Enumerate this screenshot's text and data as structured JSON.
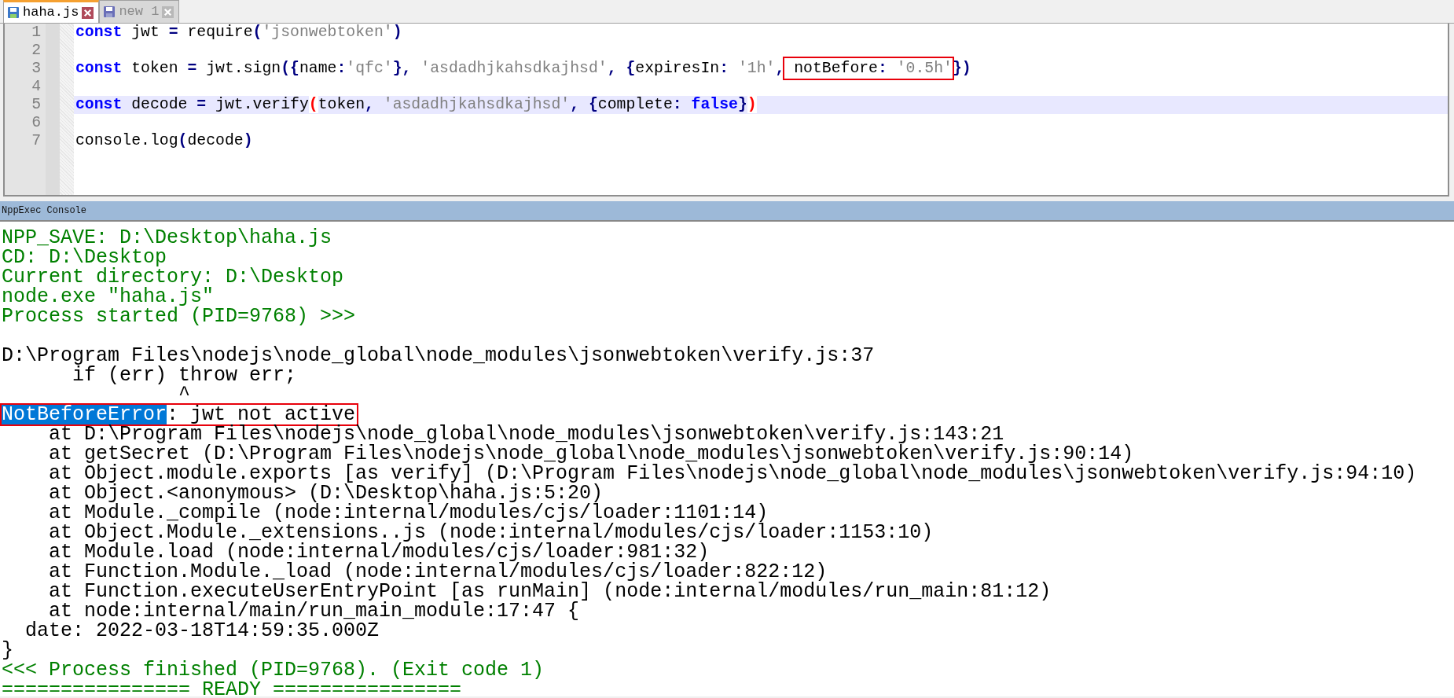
{
  "tabs": [
    {
      "label": "haha.js",
      "selected": true
    },
    {
      "label": "new 1",
      "selected": false
    }
  ],
  "editor": {
    "lines": [
      {
        "number": "1",
        "current": false,
        "tokens": [
          {
            "kind": "kw",
            "text": "const"
          },
          {
            "kind": "plain",
            "text": " jwt "
          },
          {
            "kind": "op",
            "text": "="
          },
          {
            "kind": "plain",
            "text": " require"
          },
          {
            "kind": "op",
            "text": "("
          },
          {
            "kind": "str",
            "text": "'jsonwebtoken'"
          },
          {
            "kind": "op",
            "text": ")"
          }
        ]
      },
      {
        "number": "2",
        "current": false
      },
      {
        "number": "3",
        "current": false,
        "tokens": [
          {
            "kind": "kw",
            "text": "const"
          },
          {
            "kind": "plain",
            "text": " token "
          },
          {
            "kind": "op",
            "text": "="
          },
          {
            "kind": "plain",
            "text": " jwt.sign"
          },
          {
            "kind": "op",
            "text": "({"
          },
          {
            "kind": "plain",
            "text": "name"
          },
          {
            "kind": "op",
            "text": ":"
          },
          {
            "kind": "str",
            "text": "'qfc'"
          },
          {
            "kind": "op",
            "text": "},"
          },
          {
            "kind": "str",
            "text": " 'asdadhjkahsdkajhsd'"
          },
          {
            "kind": "op",
            "text": ","
          },
          {
            "kind": "op",
            "text": " {"
          },
          {
            "kind": "plain",
            "text": "expiresIn"
          },
          {
            "kind": "op",
            "text": ":"
          },
          {
            "kind": "str",
            "text": " '1h'"
          },
          {
            "kind": "op",
            "text": ","
          },
          {
            "kind": "box",
            "tokens": [
              {
                "kind": "plain",
                "text": " notBefore"
              },
              {
                "kind": "op",
                "text": ":"
              },
              {
                "kind": "str",
                "text": " '0.5h'"
              }
            ]
          },
          {
            "kind": "op",
            "text": "})"
          }
        ]
      },
      {
        "number": "4",
        "current": false
      },
      {
        "number": "5",
        "current": true,
        "tokens": [
          {
            "kind": "kw",
            "text": "const"
          },
          {
            "kind": "plain",
            "text": " decode "
          },
          {
            "kind": "op",
            "text": "="
          },
          {
            "kind": "plain",
            "text": " jwt.verify"
          },
          {
            "kind": "bad",
            "text": "("
          },
          {
            "kind": "plain",
            "text": "token"
          },
          {
            "kind": "op",
            "text": ","
          },
          {
            "kind": "str",
            "text": " 'asdadhjkahsdkajhsd'"
          },
          {
            "kind": "op",
            "text": ","
          },
          {
            "kind": "op",
            "text": " {"
          },
          {
            "kind": "plain",
            "text": "complete"
          },
          {
            "kind": "op",
            "text": ":"
          },
          {
            "kind": "kw",
            "text": " false"
          },
          {
            "kind": "op",
            "text": "}"
          },
          {
            "kind": "bad",
            "text": ")"
          }
        ]
      },
      {
        "number": "6",
        "current": false
      },
      {
        "number": "7",
        "current": false,
        "tokens": [
          {
            "kind": "plain",
            "text": "console.log"
          },
          {
            "kind": "op",
            "text": "("
          },
          {
            "kind": "plain",
            "text": "decode"
          },
          {
            "kind": "op",
            "text": ")"
          }
        ]
      }
    ]
  },
  "console": {
    "title": "NppExec Console",
    "lines": [
      {
        "kind": "info",
        "parts": [
          {
            "text": "NPP_SAVE: D:\\Desktop\\haha.js",
            "selected": false
          }
        ]
      },
      {
        "kind": "info",
        "parts": [
          {
            "text": "CD: D:\\Desktop",
            "selected": false
          }
        ]
      },
      {
        "kind": "info",
        "parts": [
          {
            "text": "Current directory: D:\\Desktop",
            "selected": false
          }
        ]
      },
      {
        "kind": "info",
        "parts": [
          {
            "text": "node.exe \"haha.js\"",
            "selected": false
          }
        ]
      },
      {
        "kind": "info",
        "parts": [
          {
            "text": "Process started (PID=9768) >>>",
            "selected": false
          }
        ]
      },
      {
        "kind": "blank"
      },
      {
        "kind": "output",
        "parts": [
          {
            "text": "D:\\Program Files\\nodejs\\node_global\\node_modules\\jsonwebtoken\\verify.js:37",
            "selected": false
          }
        ]
      },
      {
        "kind": "output",
        "parts": [
          {
            "text": "      if (err) throw err;",
            "selected": false
          }
        ]
      },
      {
        "kind": "output",
        "parts": [
          {
            "text": "               ^",
            "selected": false
          }
        ]
      },
      {
        "kind": "output",
        "boxed": true,
        "parts": [
          {
            "text": "NotBeforeError",
            "selected": true
          },
          {
            "text": ": jwt not active",
            "selected": false
          }
        ]
      },
      {
        "kind": "output",
        "parts": [
          {
            "text": "    at D:\\Program Files\\nodejs\\node_global\\node_modules\\jsonwebtoken\\verify.js:143:21",
            "selected": false
          }
        ]
      },
      {
        "kind": "output",
        "parts": [
          {
            "text": "    at getSecret (D:\\Program Files\\nodejs\\node_global\\node_modules\\jsonwebtoken\\verify.js:90:14)",
            "selected": false
          }
        ]
      },
      {
        "kind": "output",
        "parts": [
          {
            "text": "    at Object.module.exports [as verify] (D:\\Program Files\\nodejs\\node_global\\node_modules\\jsonwebtoken\\verify.js:94:10)",
            "selected": false
          }
        ]
      },
      {
        "kind": "output",
        "parts": [
          {
            "text": "    at Object.<anonymous> (D:\\Desktop\\haha.js:5:20)",
            "selected": false
          }
        ]
      },
      {
        "kind": "output",
        "parts": [
          {
            "text": "    at Module._compile (node:internal/modules/cjs/loader:1101:14)",
            "selected": false
          }
        ]
      },
      {
        "kind": "output",
        "parts": [
          {
            "text": "    at Object.Module._extensions..js (node:internal/modules/cjs/loader:1153:10)",
            "selected": false
          }
        ]
      },
      {
        "kind": "output",
        "parts": [
          {
            "text": "    at Module.load (node:internal/modules/cjs/loader:981:32)",
            "selected": false
          }
        ]
      },
      {
        "kind": "output",
        "parts": [
          {
            "text": "    at Function.Module._load (node:internal/modules/cjs/loader:822:12)",
            "selected": false
          }
        ]
      },
      {
        "kind": "output",
        "parts": [
          {
            "text": "    at Function.executeUserEntryPoint [as runMain] (node:internal/modules/run_main:81:12)",
            "selected": false
          }
        ]
      },
      {
        "kind": "output",
        "parts": [
          {
            "text": "    at node:internal/main/run_main_module:17:47 {",
            "selected": false
          }
        ]
      },
      {
        "kind": "output",
        "parts": [
          {
            "text": "  date: 2022-03-18T14:59:35.000Z",
            "selected": false
          }
        ]
      },
      {
        "kind": "output",
        "parts": [
          {
            "text": "}",
            "selected": false
          }
        ]
      },
      {
        "kind": "info",
        "parts": [
          {
            "text": "<<< Process finished (PID=9768). (Exit code 1)",
            "selected": false
          }
        ]
      },
      {
        "kind": "info",
        "parts": [
          {
            "text": "================ READY ================",
            "selected": false
          }
        ]
      }
    ]
  }
}
